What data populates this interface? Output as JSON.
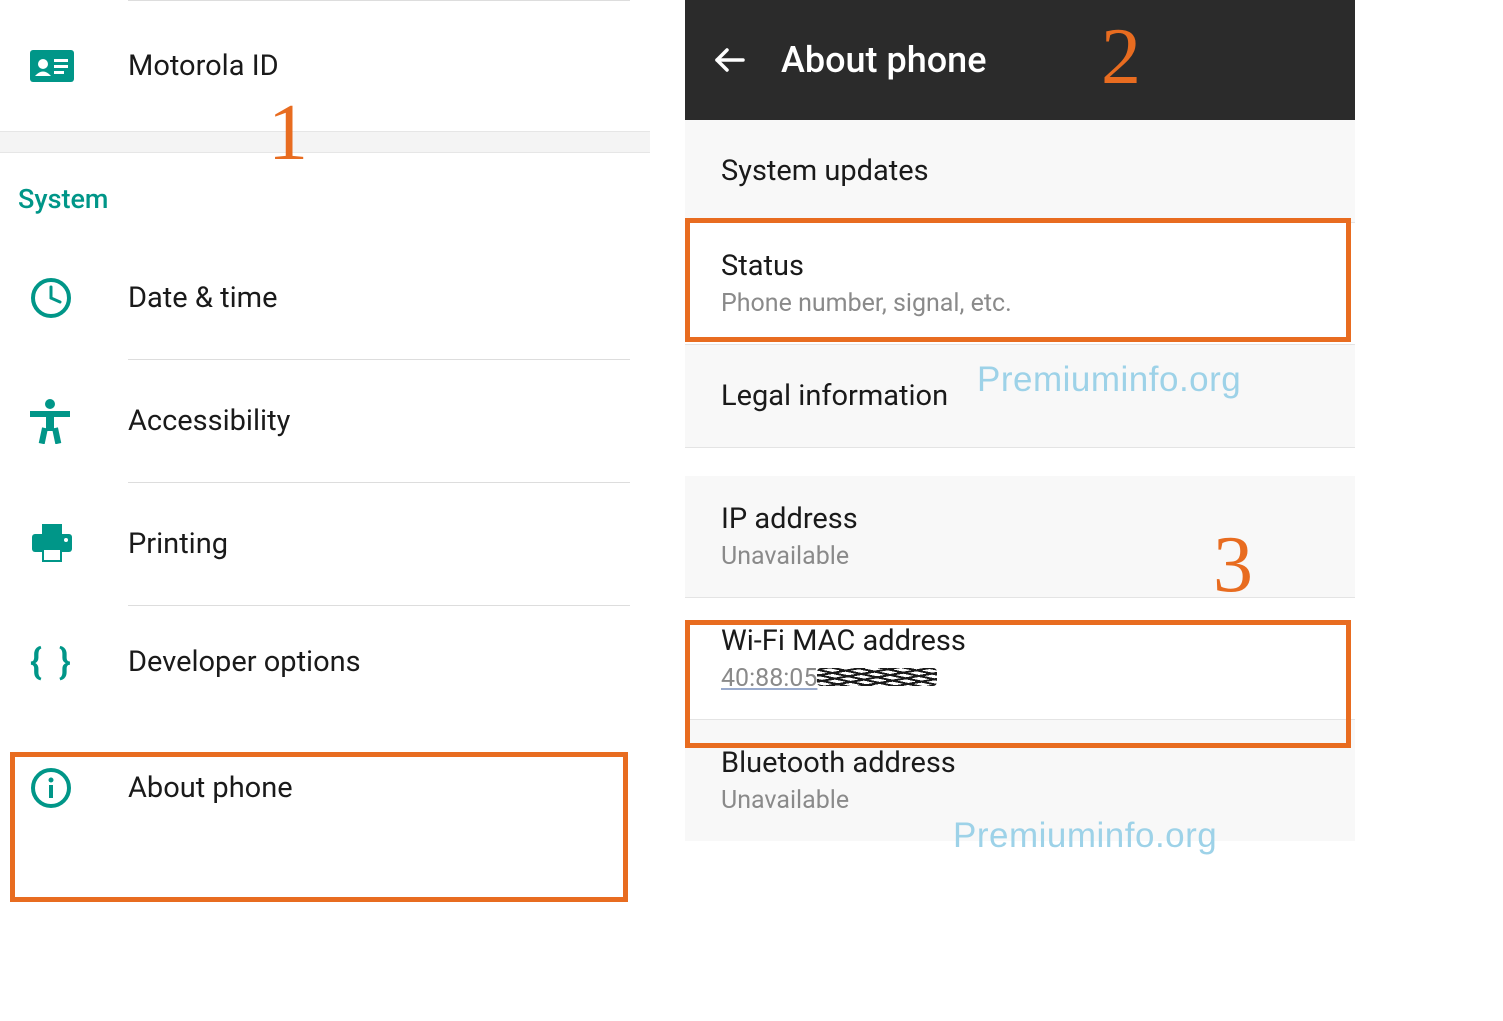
{
  "colors": {
    "accent": "#009688",
    "highlight": "#e86c20",
    "watermark": "#9dd2e8",
    "header_bg": "#2b2b2b"
  },
  "annotations": {
    "step1": "1",
    "step2": "2",
    "step3": "3",
    "watermark": "Premiuminfo.org"
  },
  "left": {
    "top_item": {
      "icon": "id-card-icon",
      "label": "Motorola ID"
    },
    "section_title": "System",
    "items": [
      {
        "icon": "clock-icon",
        "label": "Date & time"
      },
      {
        "icon": "accessibility-icon",
        "label": "Accessibility"
      },
      {
        "icon": "printer-icon",
        "label": "Printing"
      },
      {
        "icon": "braces-icon",
        "label": "Developer options"
      },
      {
        "icon": "info-icon",
        "label": "About phone"
      }
    ]
  },
  "right": {
    "header_title": "About phone",
    "rows": [
      {
        "primary": "System updates",
        "secondary": ""
      },
      {
        "primary": "Status",
        "secondary": "Phone number, signal, etc."
      },
      {
        "primary": "Legal information",
        "secondary": ""
      },
      {
        "primary": "IP address",
        "secondary": "Unavailable"
      },
      {
        "primary": "Wi-Fi MAC address",
        "secondary_prefix": "40:88:05",
        "secondary_redacted": true
      },
      {
        "primary": "Bluetooth address",
        "secondary": "Unavailable"
      }
    ]
  }
}
